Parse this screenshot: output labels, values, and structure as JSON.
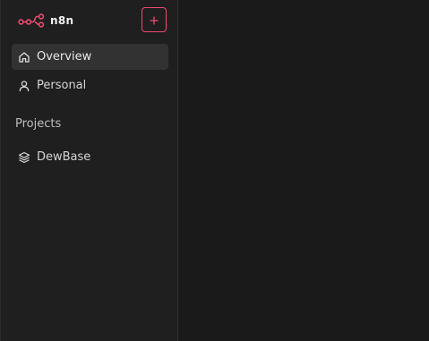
{
  "sidebar": {
    "logo": {
      "text": "n8n",
      "brand_color": "#ea4b71",
      "icon": "n8n-logo-icon"
    },
    "add_button": {
      "icon": "plus-icon"
    },
    "items": [
      {
        "label": "Overview",
        "icon": "home-icon",
        "active": true
      },
      {
        "label": "Personal",
        "icon": "user-icon",
        "active": false
      }
    ],
    "projects": {
      "title": "Projects",
      "items": [
        {
          "label": "DewBase",
          "icon": "layers-icon"
        }
      ]
    }
  },
  "colors": {
    "sidebar_bg": "#1f1f1f",
    "main_bg": "#1a1a1a",
    "active_item_bg": "#323232",
    "accent": "#ea4b71"
  }
}
